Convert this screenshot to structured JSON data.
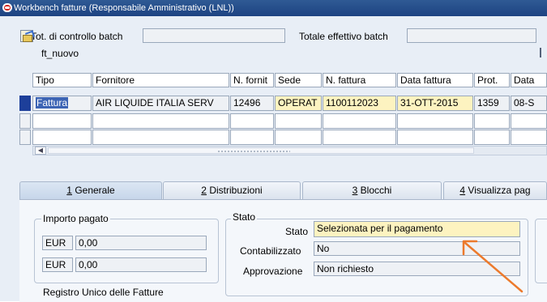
{
  "window": {
    "title": "Workbench fatture (Responsabile Amministrativo (LNL))"
  },
  "batch": {
    "control_total_label": "Tot. di controllo batch",
    "control_total_value": "",
    "actual_total_label": "Totale effettivo batch",
    "actual_total_value": ""
  },
  "toolbar": {
    "icon": "open-folder-icon",
    "label": "ft_nuovo"
  },
  "table": {
    "headers": [
      "Tipo",
      "Fornitore",
      "N. fornit",
      "Sede",
      "N. fattura",
      "Data fattura",
      "Prot.",
      "Data"
    ],
    "rows": [
      [
        "Fattura",
        "AIR LIQUIDE ITALIA SERV",
        "12496",
        "OPERAT",
        "1100112023",
        "31-OTT-2015",
        "1359",
        "08-S"
      ],
      [
        "",
        "",
        "",
        "",
        "",
        "",
        "",
        ""
      ],
      [
        "",
        "",
        "",
        "",
        "",
        "",
        "",
        ""
      ]
    ]
  },
  "scrollbar": {
    "left_arrow": "◀"
  },
  "tabs": [
    {
      "number": "1",
      "label": " Generale"
    },
    {
      "number": "2",
      "label": " Distribuzioni"
    },
    {
      "number": "3",
      "label": " Blocchi"
    },
    {
      "number": "4",
      "label": " Visualizza pag"
    }
  ],
  "importo_pagato": {
    "title": "Importo pagato",
    "rows": [
      {
        "currency": "EUR",
        "amount": "0,00"
      },
      {
        "currency": "EUR",
        "amount": "0,00"
      }
    ]
  },
  "stato": {
    "title": "Stato",
    "stato_label": "Stato",
    "stato_value": "Selezionata per il pagamento",
    "contabilizzato_label": "Contabilizzato",
    "contabilizzato_value": "No",
    "approvazione_label": "Approvazione",
    "approvazione_value": "Non richiesto"
  },
  "registro": {
    "title": "Registro Unico delle Fatture"
  },
  "colors": {
    "title_bar": "#1d4382",
    "highlight": "#fdf3c0",
    "annotation_arrow": "#ec7a2c",
    "selected_row_marker": "#1d3f9a"
  }
}
